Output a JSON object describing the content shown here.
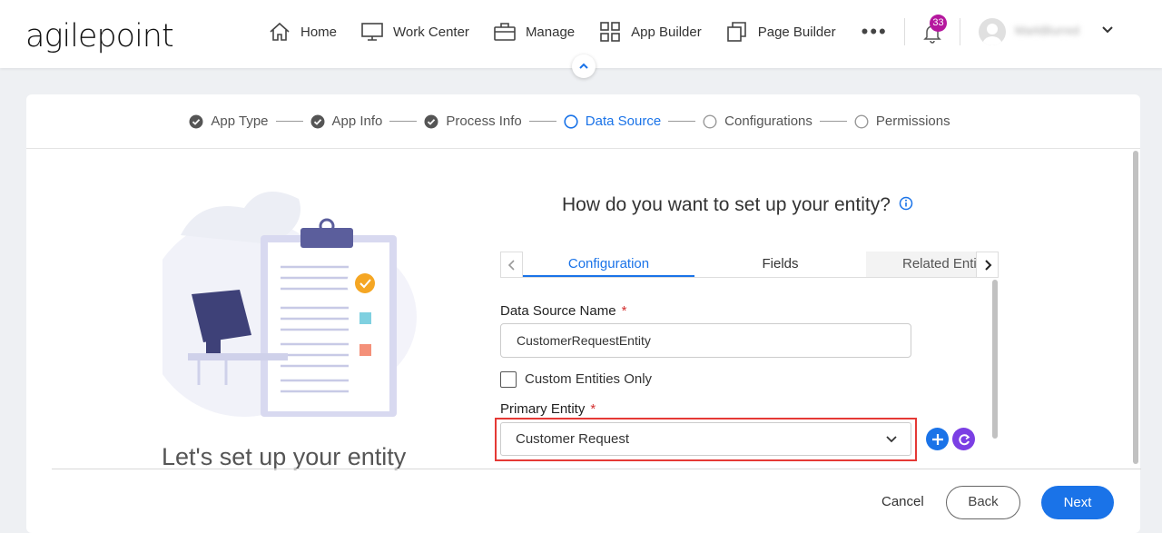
{
  "header": {
    "logo": "agilepoint",
    "nav": [
      {
        "label": "Home",
        "icon": "home-icon"
      },
      {
        "label": "Work Center",
        "icon": "monitor-icon"
      },
      {
        "label": "Manage",
        "icon": "briefcase-icon"
      },
      {
        "label": "App Builder",
        "icon": "grid-icon"
      },
      {
        "label": "Page Builder",
        "icon": "pages-icon"
      }
    ],
    "more_label": "•••",
    "notification_count": "33",
    "username": "MarkBlurred"
  },
  "stepper": {
    "steps": [
      {
        "label": "App Type",
        "state": "done"
      },
      {
        "label": "App Info",
        "state": "done"
      },
      {
        "label": "Process Info",
        "state": "done"
      },
      {
        "label": "Data Source",
        "state": "active"
      },
      {
        "label": "Configurations",
        "state": "pending"
      },
      {
        "label": "Permissions",
        "state": "pending"
      }
    ]
  },
  "illustration": {
    "caption": "Let's set up your entity"
  },
  "form": {
    "title": "How do you want to set up your entity?",
    "tabs": [
      {
        "label": "Configuration",
        "active": true
      },
      {
        "label": "Fields",
        "active": false
      },
      {
        "label": "Related Enti",
        "active": false
      }
    ],
    "data_source_name_label": "Data Source Name",
    "data_source_name_value": "CustomerRequestEntity",
    "required_mark": "*",
    "custom_entities_label": "Custom Entities Only",
    "custom_entities_checked": false,
    "primary_entity_label": "Primary Entity",
    "primary_entity_value": "Customer Request"
  },
  "footer": {
    "cancel": "Cancel",
    "back": "Back",
    "next": "Next"
  },
  "colors": {
    "accent": "#1a73e8",
    "badge": "#b5179e",
    "highlight": "#e53935",
    "refresh": "#7b3fe4"
  }
}
